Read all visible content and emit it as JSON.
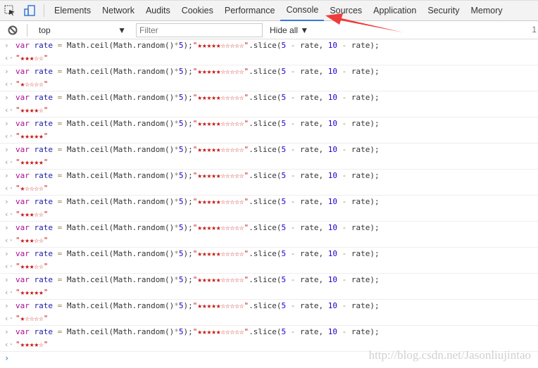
{
  "tabs": [
    "Elements",
    "Network",
    "Audits",
    "Cookies",
    "Performance",
    "Console",
    "Sources",
    "Application",
    "Security",
    "Memory"
  ],
  "active_tab": "Console",
  "filterbar": {
    "context": "top",
    "filter_placeholder": "Filter",
    "level": "Hide all",
    "count": "1"
  },
  "code": {
    "kw": "var",
    "var": "rate",
    "eq": "=",
    "call": "Math.ceil(Math.random()",
    "mul": "*",
    "five": "5",
    "close": ");",
    "str": "\"★★★★★☆☆☆☆☆\"",
    "slice": ".slice(",
    "n5": "5",
    "minus": "-",
    "n10": "10",
    "end": ");"
  },
  "results": [
    "\"★★★☆☆\"",
    "\"★☆☆☆☆\"",
    "\"★★★★☆\"",
    "\"★★★★★\"",
    "\"★★★★★\"",
    "\"★☆☆☆☆\"",
    "\"★★★☆☆\"",
    "\"★★★☆☆\"",
    "\"★★★☆☆\"",
    "\"★★★★★\"",
    "\"★☆☆☆☆\"",
    "\"★★★★☆\""
  ],
  "watermark": "http://blog.csdn.net/Jasonliujintao",
  "colors": {
    "accent": "#3879d9",
    "arrow": "#f03c3c",
    "string": "#c41a16"
  }
}
